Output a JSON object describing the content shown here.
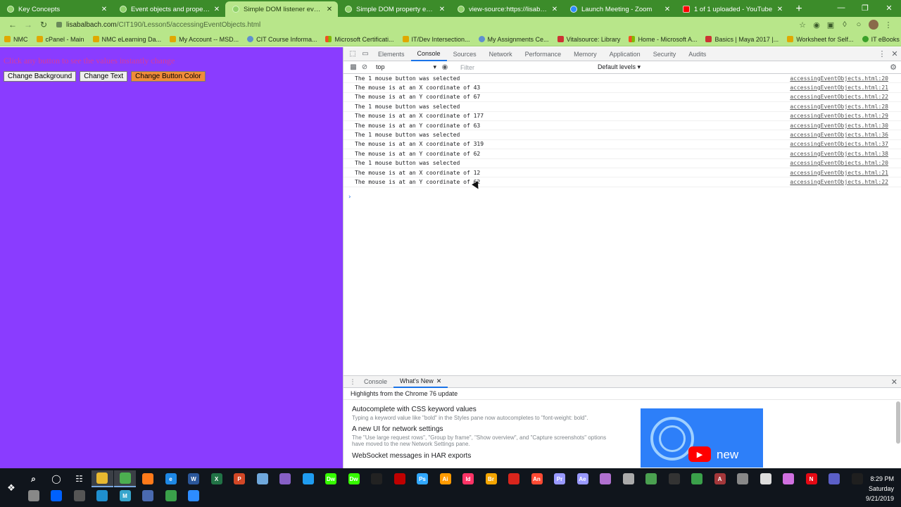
{
  "browser": {
    "tabs": [
      {
        "title": "Key Concepts",
        "icon": "green",
        "active": false
      },
      {
        "title": "Event objects and properties",
        "icon": "green",
        "active": false
      },
      {
        "title": "Simple DOM listener event hand",
        "icon": "green",
        "active": true
      },
      {
        "title": "Simple DOM property event han",
        "icon": "green",
        "active": false
      },
      {
        "title": "view-source:https://lisabalbach.",
        "icon": "green",
        "active": false
      },
      {
        "title": "Launch Meeting - Zoom",
        "icon": "zoom",
        "active": false
      },
      {
        "title": "1 of 1 uploaded - YouTube",
        "icon": "yt",
        "active": false
      }
    ],
    "url_host": "lisabalbach.com",
    "url_path": "/CIT190/Lesson5/accessingEventObjects.html",
    "bookmarks": [
      {
        "label": "NMC",
        "icon": "folder"
      },
      {
        "label": "cPanel - Main",
        "icon": "folder"
      },
      {
        "label": "NMC eLearning Da...",
        "icon": "folder"
      },
      {
        "label": "My Account -- MSD...",
        "icon": "folder"
      },
      {
        "label": "CIT Course Informa...",
        "icon": "globe"
      },
      {
        "label": "Microsoft Certificati...",
        "icon": "ms"
      },
      {
        "label": "IT/Dev Intersection...",
        "icon": "folder"
      },
      {
        "label": "My Assignments Ce...",
        "icon": "globe"
      },
      {
        "label": "Vitalsource: Library",
        "icon": "adobe"
      },
      {
        "label": "Home - Microsoft A...",
        "icon": "ms"
      },
      {
        "label": "Basics | Maya 2017 |...",
        "icon": "adobe"
      },
      {
        "label": "Worksheet for Self...",
        "icon": "folder"
      },
      {
        "label": "IT eBooks - Free Do...",
        "icon": "green"
      }
    ]
  },
  "page": {
    "heading": "Click any button to see the values instantly change",
    "buttons": [
      {
        "label": "Change Background",
        "style": "default"
      },
      {
        "label": "Change Text",
        "style": "default"
      },
      {
        "label": "Change Button Color",
        "style": "orange"
      }
    ]
  },
  "devtools": {
    "tabs": [
      "Elements",
      "Console",
      "Sources",
      "Network",
      "Performance",
      "Memory",
      "Application",
      "Security",
      "Audits"
    ],
    "active_tab": "Console",
    "context": "top",
    "filter_placeholder": "Filter",
    "levels": "Default levels",
    "messages": [
      {
        "text": "The 1 mouse button was selected",
        "source": "accessingEventObjects.html:20"
      },
      {
        "text": "The mouse is at an X coordinate of 43",
        "source": "accessingEventObjects.html:21"
      },
      {
        "text": "The mouse is at an Y coordinate of 67",
        "source": "accessingEventObjects.html:22"
      },
      {
        "text": "The 1 mouse button was selected",
        "source": "accessingEventObjects.html:28"
      },
      {
        "text": "The mouse is at an X coordinate of 177",
        "source": "accessingEventObjects.html:29"
      },
      {
        "text": "The mouse is at an Y coordinate of 63",
        "source": "accessingEventObjects.html:30"
      },
      {
        "text": "The 1 mouse button was selected",
        "source": "accessingEventObjects.html:36"
      },
      {
        "text": "The mouse is at an X coordinate of 319",
        "source": "accessingEventObjects.html:37"
      },
      {
        "text": "The mouse is at an Y coordinate of 62",
        "source": "accessingEventObjects.html:38"
      },
      {
        "text": "The 1 mouse button was selected",
        "source": "accessingEventObjects.html:20"
      },
      {
        "text": "The mouse is at an X coordinate of 12",
        "source": "accessingEventObjects.html:21"
      },
      {
        "text": "The mouse is at an Y coordinate of 62",
        "source": "accessingEventObjects.html:22"
      }
    ],
    "drawer": {
      "tabs": [
        "Console",
        "What's New"
      ],
      "active_tab": "What's New",
      "highlights_title": "Highlights from the Chrome 76 update",
      "items": [
        {
          "title": "Autocomplete with CSS keyword values",
          "desc": "Typing a keyword value like \"bold\" in the Styles pane now autocompletes to \"font-weight: bold\"."
        },
        {
          "title": "A new UI for network settings",
          "desc": "The \"Use large request rows\", \"Group by frame\", \"Show overview\", and \"Capture screenshots\" options have moved to the new Network Settings pane."
        },
        {
          "title": "WebSocket messages in HAR exports",
          "desc": ""
        }
      ],
      "image_text": "new"
    }
  },
  "taskbar": {
    "apps": [
      {
        "name": "file-explorer",
        "color": "#e8b830",
        "label": ""
      },
      {
        "name": "chrome",
        "color": "#4caf50",
        "label": ""
      },
      {
        "name": "firefox",
        "color": "#ff7a1a",
        "label": ""
      },
      {
        "name": "edge",
        "color": "#1e88e5",
        "label": "e"
      },
      {
        "name": "word",
        "color": "#2b579a",
        "label": "W"
      },
      {
        "name": "excel",
        "color": "#217346",
        "label": "X"
      },
      {
        "name": "powerpoint",
        "color": "#d24726",
        "label": "P"
      },
      {
        "name": "notepad",
        "color": "#6fa8dc",
        "label": ""
      },
      {
        "name": "visual-studio",
        "color": "#865fc5",
        "label": ""
      },
      {
        "name": "vscode",
        "color": "#1f9cf0",
        "label": ""
      },
      {
        "name": "dreamweaver",
        "color": "#35fa00",
        "label": "Dw"
      },
      {
        "name": "dreamweaver-2",
        "color": "#35fa00",
        "label": "Dw"
      },
      {
        "name": "terminal",
        "color": "#222222",
        "label": ""
      },
      {
        "name": "filezilla",
        "color": "#bf0000",
        "label": ""
      },
      {
        "name": "photoshop",
        "color": "#31a8ff",
        "label": "Ps"
      },
      {
        "name": "illustrator",
        "color": "#ff9a00",
        "label": "Ai"
      },
      {
        "name": "indesign",
        "color": "#ff3366",
        "label": "Id"
      },
      {
        "name": "bridge",
        "color": "#f4a500",
        "label": "Br"
      },
      {
        "name": "acrobat",
        "color": "#d9251c",
        "label": ""
      },
      {
        "name": "animate",
        "color": "#ff4a33",
        "label": "An"
      },
      {
        "name": "premiere",
        "color": "#9999ff",
        "label": "Pr"
      },
      {
        "name": "after-effects",
        "color": "#9999ff",
        "label": "Ae"
      },
      {
        "name": "app-circle",
        "color": "#b070d0",
        "label": ""
      },
      {
        "name": "app-bar",
        "color": "#aaaaaa",
        "label": ""
      },
      {
        "name": "app-diamond",
        "color": "#4aa050",
        "label": ""
      },
      {
        "name": "app-dark",
        "color": "#333333",
        "label": ""
      },
      {
        "name": "app-leaf",
        "color": "#3aa04a",
        "label": ""
      },
      {
        "name": "access",
        "color": "#a4373a",
        "label": "A"
      },
      {
        "name": "app-cloud",
        "color": "#888888",
        "label": ""
      },
      {
        "name": "unity",
        "color": "#dddddd",
        "label": ""
      },
      {
        "name": "itunes",
        "color": "#d070e0",
        "label": ""
      },
      {
        "name": "netflix",
        "color": "#e50914",
        "label": "N"
      },
      {
        "name": "teams",
        "color": "#5b5fc7",
        "label": ""
      },
      {
        "name": "settings",
        "color": "#1f1f1f",
        "label": ""
      },
      {
        "name": "app-round",
        "color": "#888888",
        "label": ""
      },
      {
        "name": "dropbox",
        "color": "#0061ff",
        "label": ""
      },
      {
        "name": "media",
        "color": "#555555",
        "label": ""
      },
      {
        "name": "app-globe",
        "color": "#1f8fcf",
        "label": ""
      },
      {
        "name": "maya",
        "color": "#37a5cc",
        "label": "M"
      },
      {
        "name": "app-person",
        "color": "#4a6ab0",
        "label": ""
      },
      {
        "name": "app-arrow",
        "color": "#3aa04a",
        "label": ""
      },
      {
        "name": "zoom",
        "color": "#2d8cff",
        "label": ""
      }
    ],
    "time": "8:29 PM",
    "day": "Saturday",
    "date": "9/21/2019"
  }
}
